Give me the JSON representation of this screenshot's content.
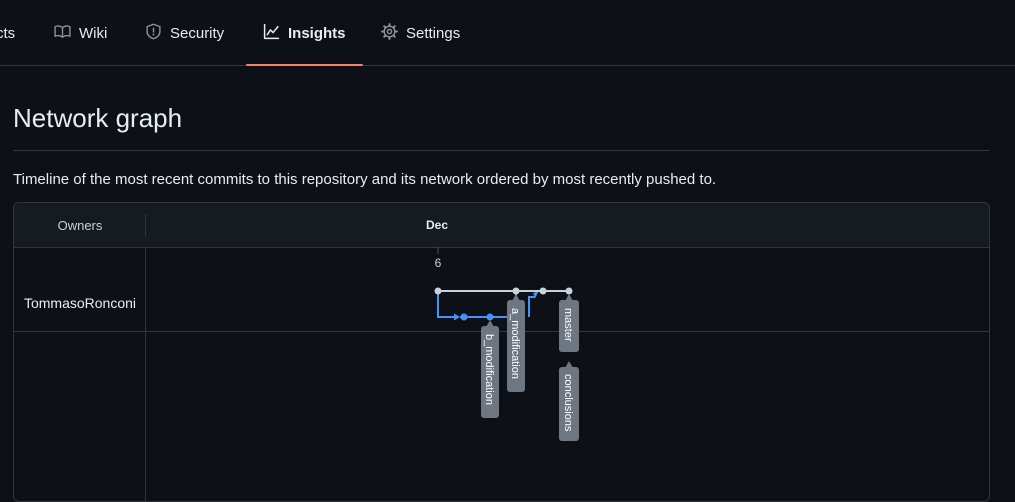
{
  "tabs": [
    {
      "label": "cts",
      "icon": "project-icon",
      "active": false
    },
    {
      "label": "Wiki",
      "icon": "book-icon",
      "active": false
    },
    {
      "label": "Security",
      "icon": "shield-icon",
      "active": false
    },
    {
      "label": "Insights",
      "icon": "graph-icon",
      "active": true
    },
    {
      "label": "Settings",
      "icon": "gear-icon",
      "active": false
    }
  ],
  "page": {
    "title": "Network graph",
    "description": "Timeline of the most recent commits to this repository and its network ordered by most recently pushed to."
  },
  "network": {
    "owners_header": "Owners",
    "month": "Dec",
    "day": "6",
    "owners": [
      {
        "name": "TommasoRonconi"
      }
    ],
    "branch_labels": {
      "b_modification": "b_modification",
      "a_modification": "a_modification",
      "master": "master",
      "conclusions": "conclusions"
    },
    "colors": {
      "main_line": "#c9d1d9",
      "branch_line": "#4493f8",
      "label_bg": "#6e7681",
      "label_text": "#ffffff"
    }
  }
}
